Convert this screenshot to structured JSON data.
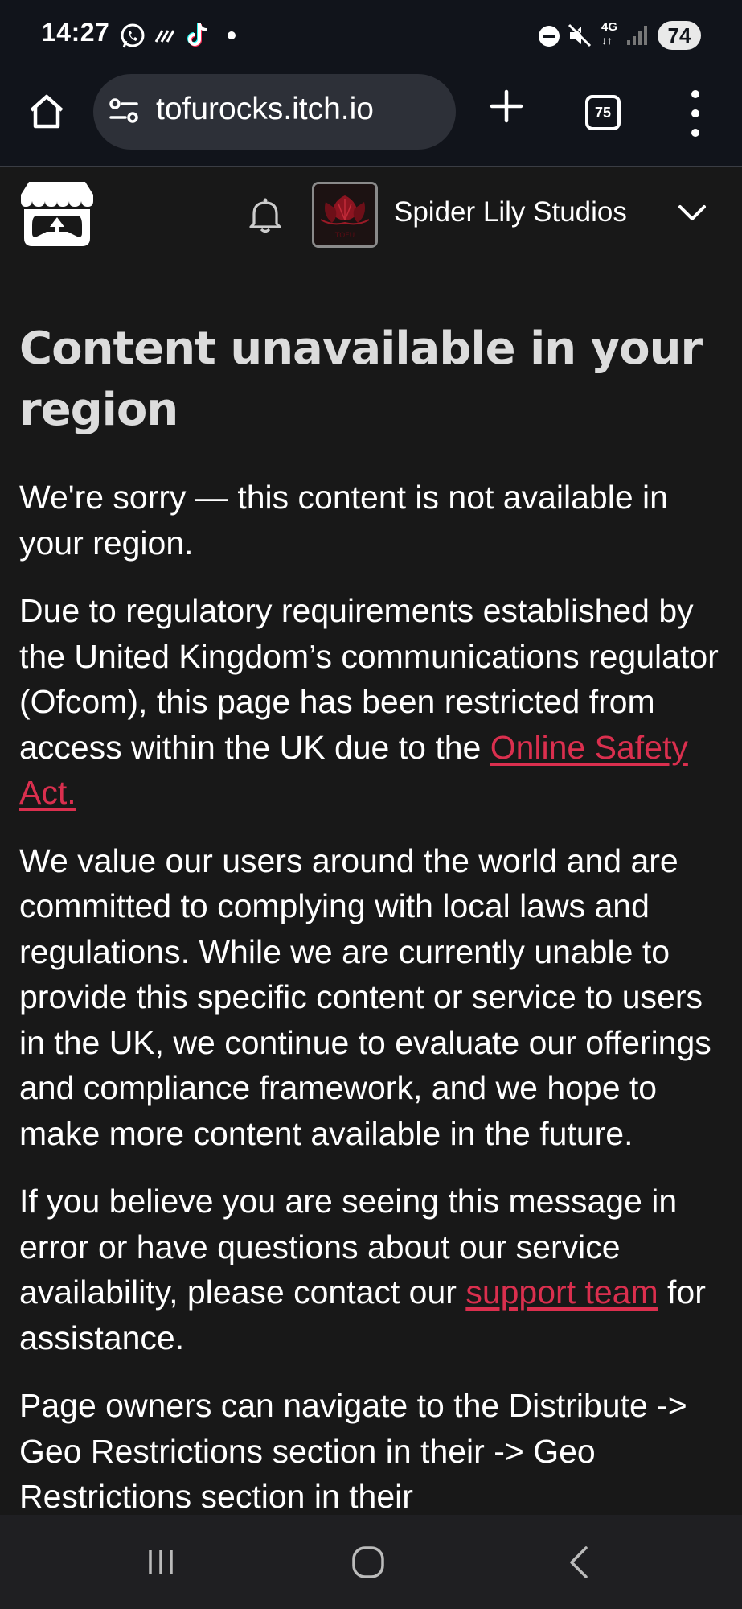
{
  "status_bar": {
    "time": "14:27",
    "network": "4G",
    "battery": "74",
    "icons": [
      "whatsapp-icon",
      "tiktok-icon",
      "notification-dot-icon",
      "dnd-icon",
      "mute-icon",
      "signal-icon"
    ]
  },
  "browser": {
    "url": "tofurocks.itch.io",
    "tab_count": "75"
  },
  "site_header": {
    "studio_name": "Spider Lily Studios",
    "avatar_text": "TOFU"
  },
  "page": {
    "title": "Content unavailable in your region",
    "p1": "We're sorry — this content is not available in your region.",
    "p2_before_link": "Due to regulatory requirements established by the United Kingdom’s communications regulator (Ofcom), this page has been restricted from access within the UK due to the ",
    "p2_link": "Online Safety Act.",
    "p3": "We value our users around the world and are committed to complying with local laws and regulations. While we are currently unable to provide this specific content or service to users in the UK, we continue to evaluate our offerings and compliance framework, and we hope to make more content available in the future.",
    "p4_before_link": "If you believe you are seeing this message in error or have questions about our service availability, please contact our ",
    "p4_link": "support team",
    "p4_after_link": " for assistance.",
    "p5": "Page owners can navigate to the Distribute -> Geo Restrictions section in their"
  },
  "colors": {
    "link": "#da2f4e",
    "chrome_bg": "#11141b",
    "page_bg": "#181818"
  }
}
